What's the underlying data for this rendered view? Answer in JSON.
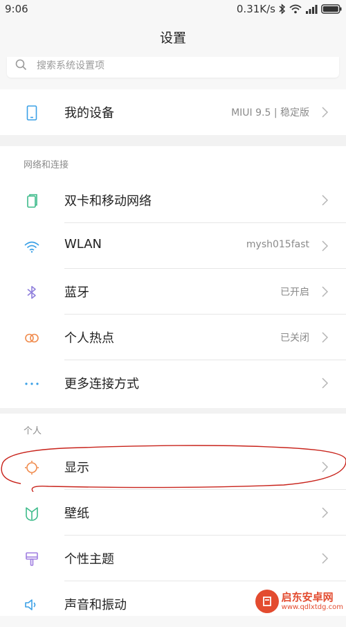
{
  "status_bar": {
    "time": "9:06",
    "network_speed": "0.31K/s"
  },
  "title": "设置",
  "search": {
    "placeholder": "搜索系统设置项"
  },
  "device": {
    "label": "我的设备",
    "value": "MIUI 9.5 | 稳定版"
  },
  "network_section": {
    "header": "网络和连接",
    "items": [
      {
        "label": "双卡和移动网络",
        "value": ""
      },
      {
        "label": "WLAN",
        "value": "mysh015fast"
      },
      {
        "label": "蓝牙",
        "value": "已开启"
      },
      {
        "label": "个人热点",
        "value": "已关闭"
      },
      {
        "label": "更多连接方式",
        "value": ""
      }
    ]
  },
  "personal_section": {
    "header": "个人",
    "items": [
      {
        "label": "显示",
        "value": ""
      },
      {
        "label": "壁纸",
        "value": ""
      },
      {
        "label": "个性主题",
        "value": ""
      },
      {
        "label": "声音和振动",
        "value": ""
      }
    ]
  },
  "watermark": {
    "title": "启东安卓网",
    "url": "www.qdlxtdg.com"
  },
  "colors": {
    "device_icon": "#3aa0e6",
    "sim_icon": "#3dbb8a",
    "wlan_icon": "#3aa0e6",
    "bluetooth_icon": "#8f7fdc",
    "hotspot_icon": "#f08a4b",
    "more_icon": "#3aa0e6",
    "display_icon": "#f08a4b",
    "wallpaper_icon": "#3dbb8a",
    "theme_icon": "#a07ee0",
    "sound_icon": "#3aa0e6",
    "annotation": "#c8221a"
  }
}
